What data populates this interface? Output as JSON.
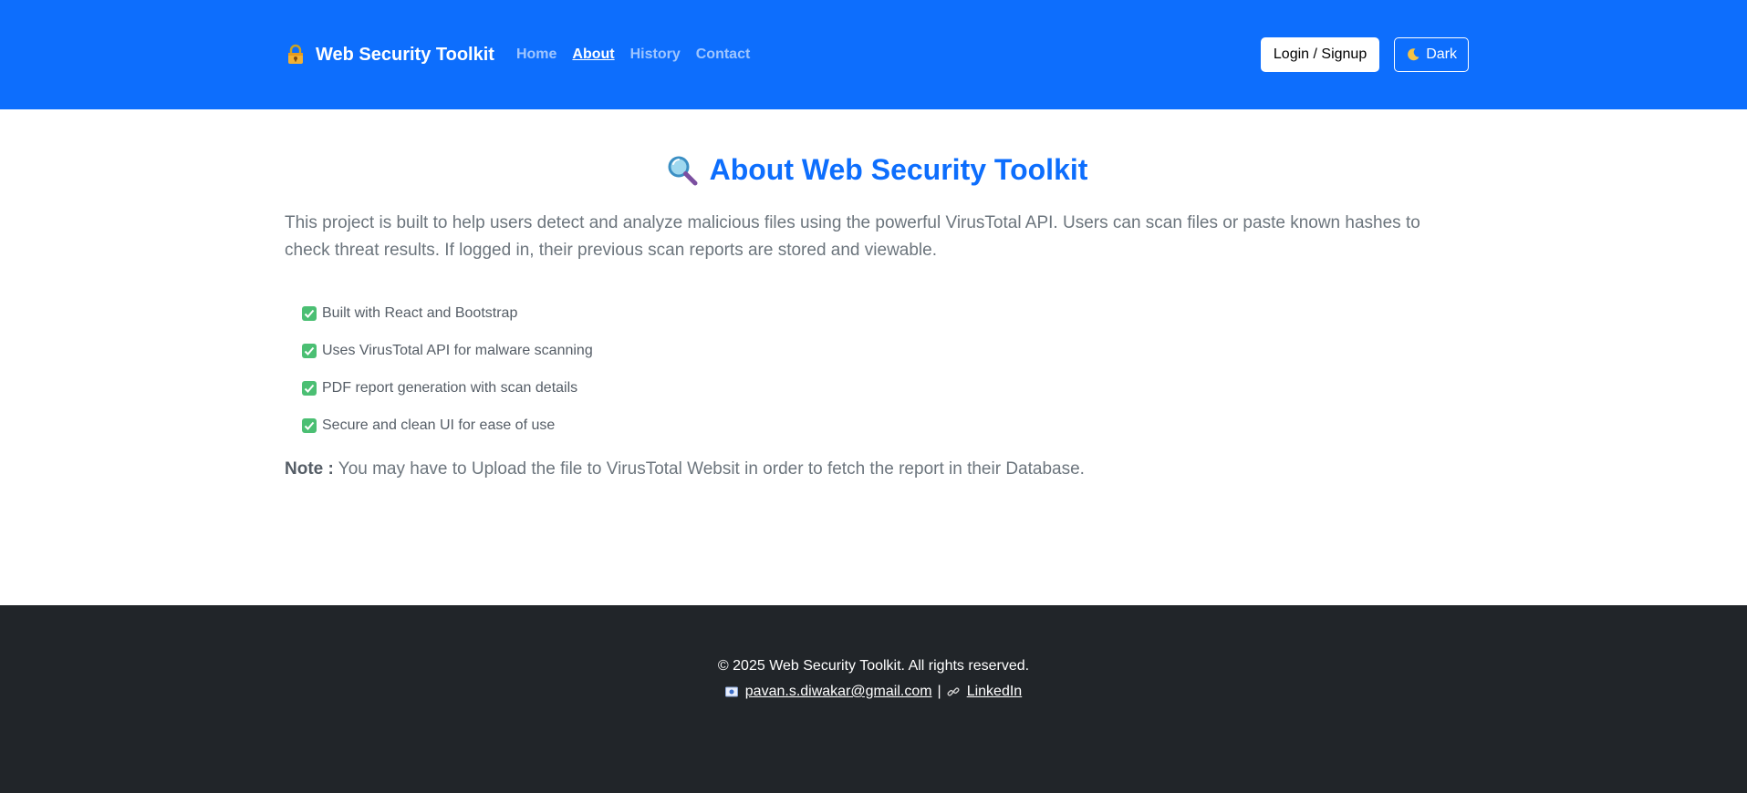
{
  "navbar": {
    "brand_label": "Web Security Toolkit",
    "brand_icon": "lock-icon",
    "links": [
      {
        "label": "Home",
        "active": false
      },
      {
        "label": "About",
        "active": true
      },
      {
        "label": "History",
        "active": false
      },
      {
        "label": "Contact",
        "active": false
      }
    ],
    "login_label": "Login / Signup",
    "dark_label": "Dark",
    "dark_icon": "moon-icon"
  },
  "main": {
    "title": "About Web Security Toolkit",
    "title_icon": "magnifier-icon",
    "intro": "This project is built to help users detect and analyze malicious files using the powerful VirusTotal API. Users can scan files or paste known hashes to check threat results. If logged in, their previous scan reports are stored and viewable.",
    "features": [
      "Built with React and Bootstrap",
      "Uses VirusTotal API for malware scanning",
      "PDF report generation with scan details",
      "Secure and clean UI for ease of use"
    ],
    "note_label": "Note :",
    "note_text": "You may have to Upload the file to VirusTotal Websit in order to fetch the report in their Database."
  },
  "footer": {
    "copyright": "© 2025 Web Security Toolkit. All rights reserved.",
    "email": "pavan.s.diwakar@gmail.com",
    "separator": "|",
    "linkedin_label": "LinkedIn"
  },
  "colors": {
    "primary": "#0d6efd",
    "footer_bg": "#212529",
    "muted_text": "#6c757d",
    "check_green": "#4bbf73"
  }
}
